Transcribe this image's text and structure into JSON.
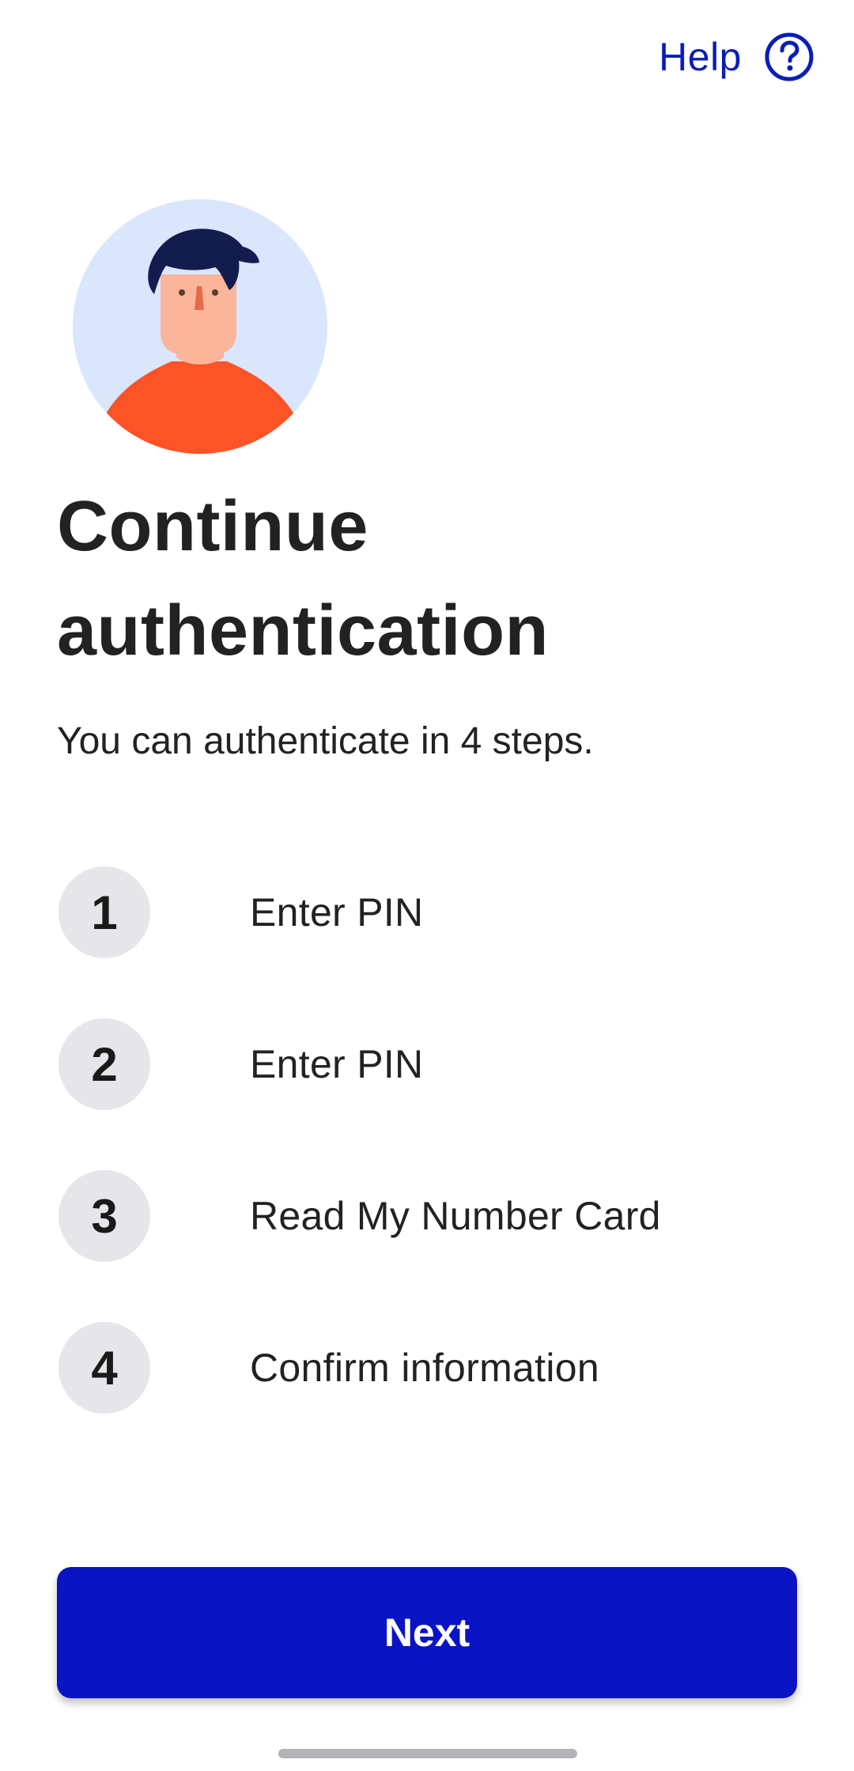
{
  "header": {
    "help_label": "Help",
    "help_icon": "question-circle-icon",
    "accent_color": "#0a1db8"
  },
  "illustration": {
    "icon": "person-avatar-icon",
    "background_color": "#d9e6fb",
    "shirt_color": "#fc5427",
    "hair_color": "#121c4d",
    "skin_color": "#fbb59a"
  },
  "main": {
    "title": "Continue authentication",
    "subtitle": "You can authenticate in 4 steps."
  },
  "steps": [
    {
      "number": "1",
      "label": "Enter PIN"
    },
    {
      "number": "2",
      "label": "Enter PIN"
    },
    {
      "number": "3",
      "label": "Read My Number Card"
    },
    {
      "number": "4",
      "label": "Confirm information"
    }
  ],
  "footer": {
    "next_label": "Next",
    "button_color": "#0a14c4"
  }
}
